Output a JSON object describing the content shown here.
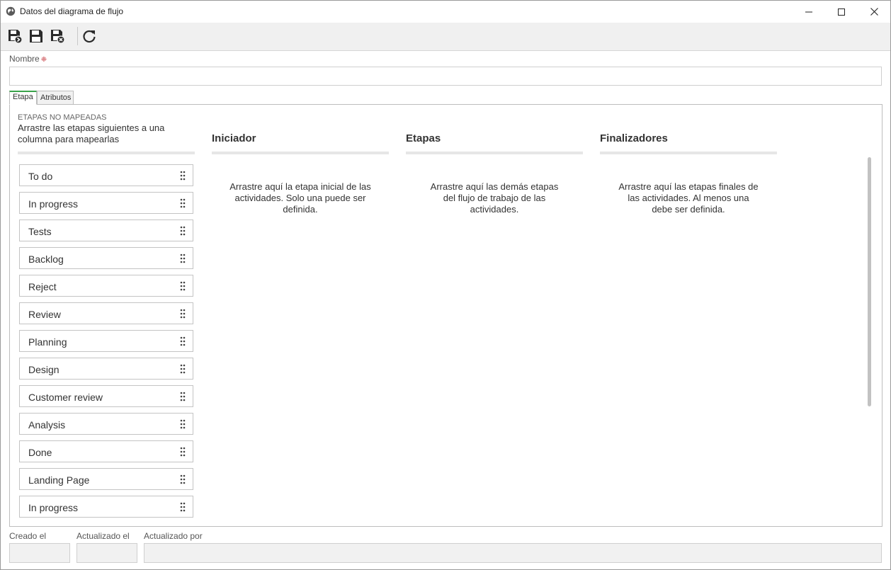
{
  "window": {
    "title": "Datos del diagrama de flujo"
  },
  "toolbar": {
    "buttons": [
      "save-and-new-icon",
      "save-icon",
      "save-and-close-icon",
      "refresh-icon"
    ]
  },
  "form": {
    "name_label": "Nombre",
    "name_value": "",
    "name_placeholder": ""
  },
  "tabs": [
    {
      "label": "Etapa",
      "active": true
    },
    {
      "label": "Atributos",
      "active": false
    }
  ],
  "unmapped": {
    "title": "ETAPAS NO MAPEADAS",
    "description": "Arrastre las etapas siguientes a una columna para mapearlas",
    "stages": [
      "To do",
      "In progress",
      "Tests",
      "Backlog",
      "Reject",
      "Review",
      "Planning",
      "Design",
      "Customer review",
      "Analysis",
      "Done",
      "Landing Page",
      "In progress"
    ]
  },
  "columns": [
    {
      "header": "Iniciador",
      "hint": "Arrastre aquí la etapa inicial de las actividades. Solo una puede ser definida."
    },
    {
      "header": "Etapas",
      "hint": "Arrastre aquí las demás etapas del flujo de trabajo de las actividades."
    },
    {
      "header": "Finalizadores",
      "hint": "Arrastre aquí las etapas finales de las actividades. Al menos una debe ser definida."
    }
  ],
  "footer": {
    "created_label": "Creado el",
    "created_value": "",
    "updated_label": "Actualizado el",
    "updated_value": "",
    "updated_by_label": "Actualizado por",
    "updated_by_value": ""
  },
  "colors": {
    "active_tab_accent": "#3aa34a",
    "required_marker": "#c0262d",
    "toolbar_bg": "#f0f0f0"
  }
}
